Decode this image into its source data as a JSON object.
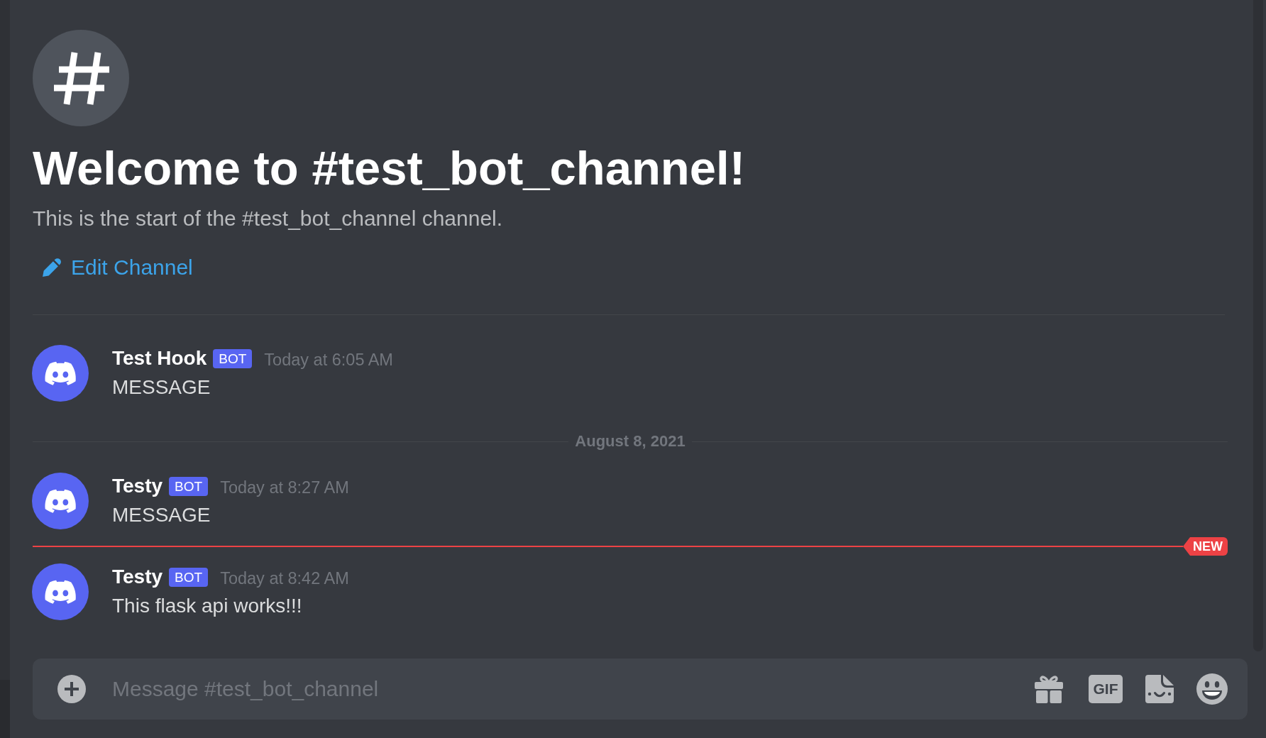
{
  "channel_intro": {
    "title": "Welcome to #test_bot_channel!",
    "description": "This is the start of the #test_bot_channel channel.",
    "edit_link": "Edit Channel"
  },
  "feed": [
    {
      "kind": "message",
      "author": "Test Hook",
      "badge": "BOT",
      "timestamp": "Today at 6:05 AM",
      "text": "MESSAGE"
    },
    {
      "kind": "date_divider",
      "label": "August 8, 2021"
    },
    {
      "kind": "message",
      "author": "Testy",
      "badge": "BOT",
      "timestamp": "Today at 8:27 AM",
      "text": "MESSAGE"
    },
    {
      "kind": "new_divider",
      "label": "NEW"
    },
    {
      "kind": "message",
      "author": "Testy",
      "badge": "BOT",
      "timestamp": "Today at 8:42 AM",
      "text": "This flask api works!!!"
    }
  ],
  "composer": {
    "placeholder": "Message #test_bot_channel",
    "gif_label": "GIF"
  }
}
